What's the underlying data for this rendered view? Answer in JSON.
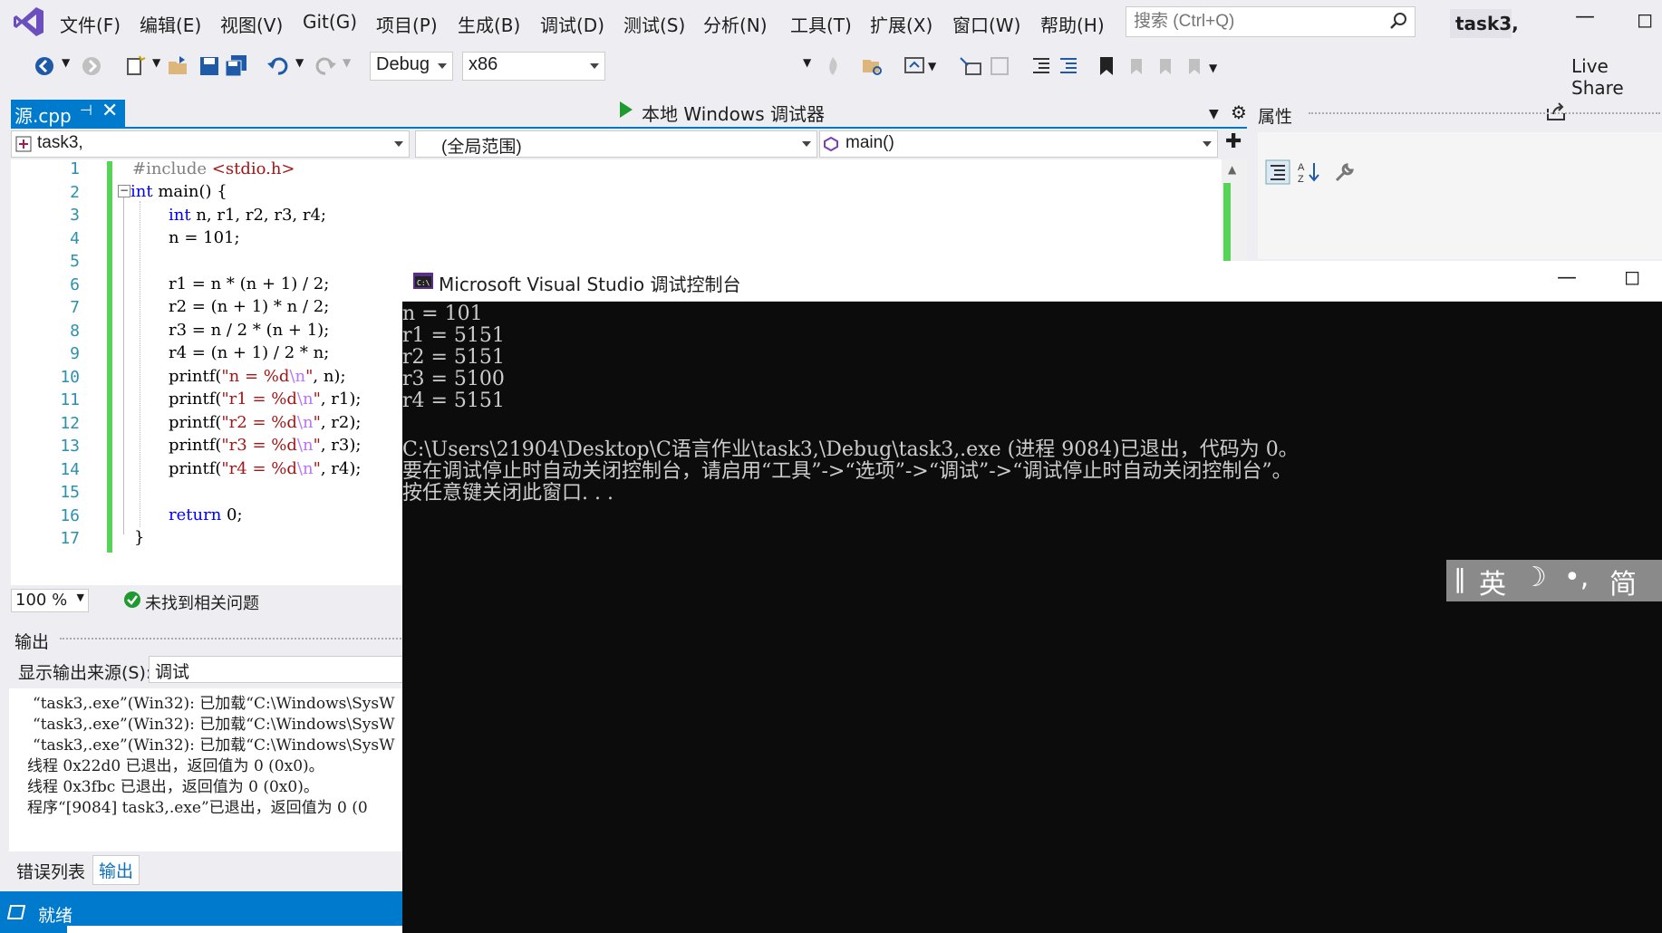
{
  "menu": {
    "items": [
      "文件(F)",
      "编辑(E)",
      "视图(V)",
      "Git(G)",
      "项目(P)",
      "生成(B)",
      "调试(D)",
      "测试(S)",
      "分析(N)",
      "工具(T)",
      "扩展(X)",
      "窗口(W)",
      "帮助(H)"
    ],
    "search_placeholder": "搜索 (Ctrl+Q)",
    "solution_name": "task3,"
  },
  "toolbar": {
    "config": "Debug",
    "platform": "x86",
    "run_label": "本地 Windows 调试器",
    "live_share": "Live Share"
  },
  "editor": {
    "tab_label": "源.cpp",
    "nav_project": "task3,",
    "nav_scope": "(全局范围)",
    "nav_member": "main()",
    "zoom": "100 %",
    "issues": "未找到相关问题",
    "lines": [
      "1",
      "2",
      "3",
      "4",
      "5",
      "6",
      "7",
      "8",
      "9",
      "10",
      "11",
      "12",
      "13",
      "14",
      "15",
      "16",
      "17"
    ]
  },
  "output": {
    "title": "输出",
    "source_label": "显示输出来源(S):",
    "source_value": "调试",
    "lines": [
      "“task3,.exe”(Win32): 已加载“C:\\Windows\\SysW",
      "“task3,.exe”(Win32): 已加载“C:\\Windows\\SysW",
      "“task3,.exe”(Win32): 已加载“C:\\Windows\\SysW",
      "线程 0x22d0 已退出，返回值为 0 (0x0)。",
      "线程 0x3fbc 已退出，返回值为 0 (0x0)。",
      "程序“[9084] task3,.exe”已退出，返回值为 0 (0"
    ],
    "tab_errors": "错误列表",
    "tab_output": "输出"
  },
  "status": {
    "text": "就绪"
  },
  "properties": {
    "title": "属性"
  },
  "console": {
    "title": "Microsoft Visual Studio 调试控制台",
    "lines": [
      "n = 101",
      "r1 = 5151",
      "r2 = 5151",
      "r3 = 5100",
      "r4 = 5151",
      "",
      "C:\\Users\\21904\\Desktop\\C语言作业\\task3,\\Debug\\task3,.exe (进程 9084)已退出，代码为 0。",
      "要在调试停止时自动关闭控制台，请启用“工具”->“选项”->“调试”->“调试停止时自动关闭控制台”。",
      "按任意键关闭此窗口. . ."
    ]
  },
  "ime": {
    "lang": "英",
    "moon": "☽",
    "punct": "•,",
    "simp": "简"
  }
}
